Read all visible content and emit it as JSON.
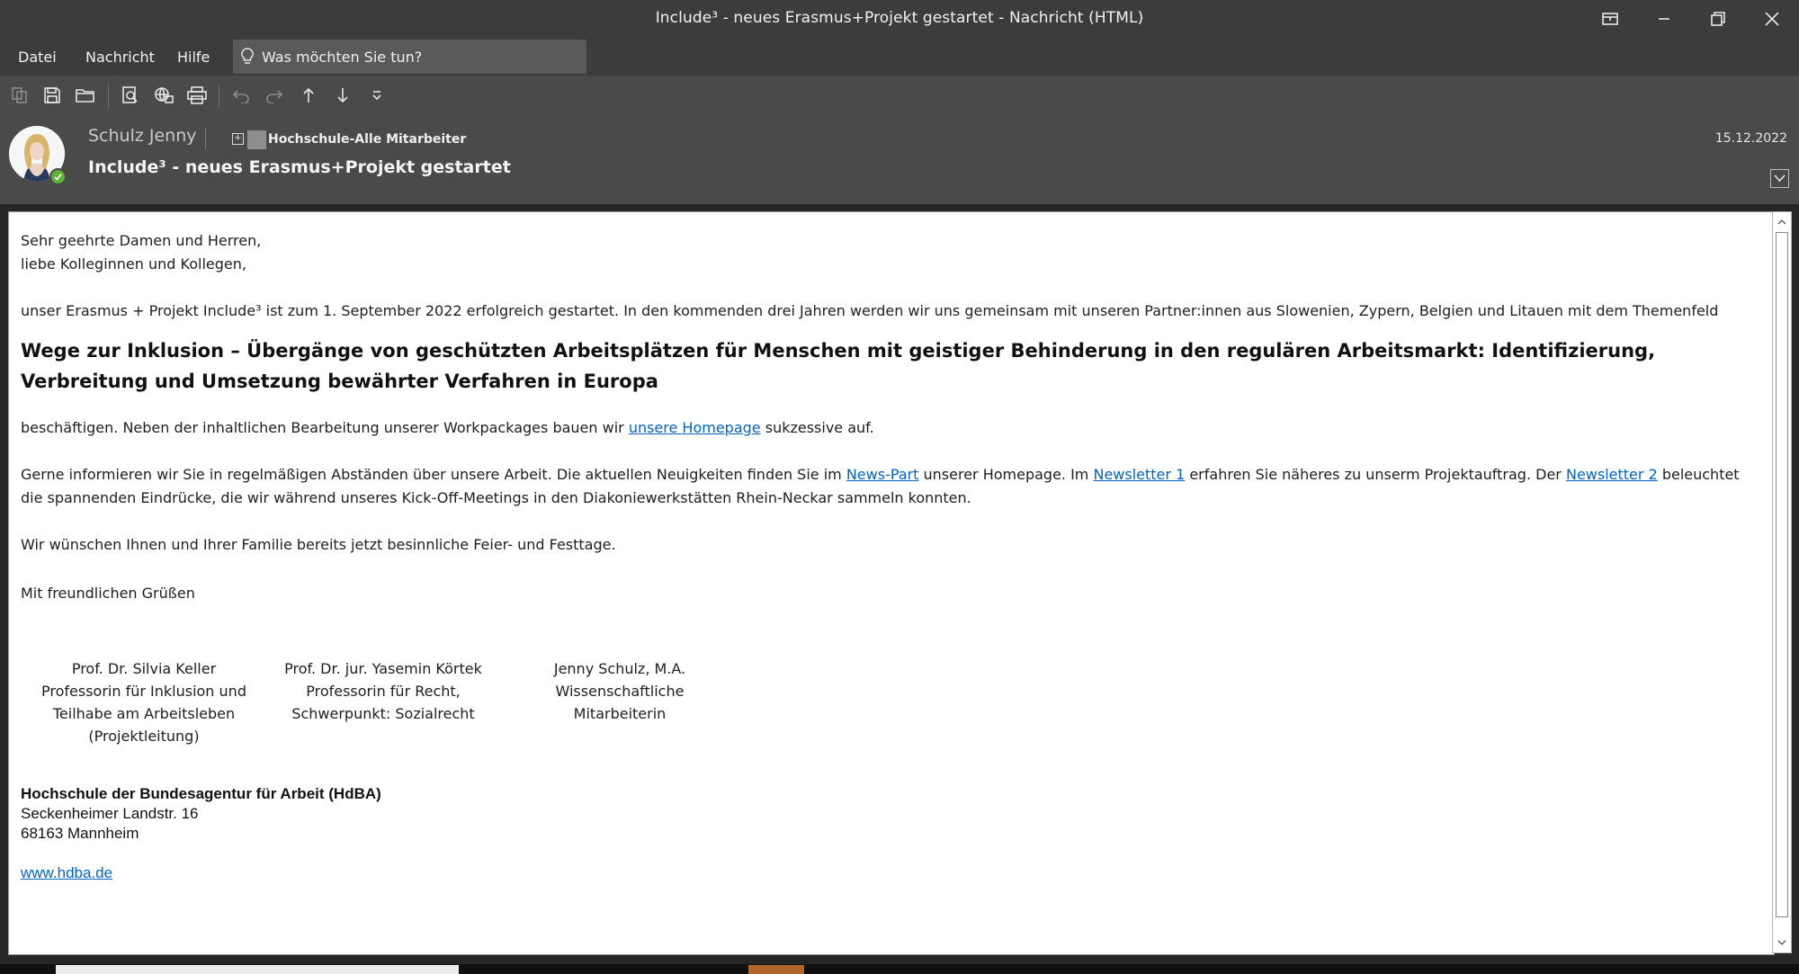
{
  "window": {
    "title": "Include³ - neues Erasmus+Projekt gestartet  -  Nachricht (HTML)"
  },
  "menu": {
    "items": [
      "Datei",
      "Nachricht",
      "Hilfe"
    ],
    "tell_me_placeholder": "Was möchten Sie tun?"
  },
  "header": {
    "sender": "Schulz Jenny",
    "recipient": "Hochschule-Alle Mitarbeiter",
    "subject": "Include³ - neues Erasmus+Projekt gestartet",
    "date": "15.12.2022"
  },
  "mail": {
    "greeting1": "Sehr geehrte Damen und Herren,",
    "greeting2": "liebe Kolleginnen und Kollegen,",
    "intro": "unser Erasmus + Projekt Include³ ist zum 1. September 2022 erfolgreich gestartet. In den kommenden drei Jahren werden wir uns gemeinsam mit unseren Partner:innen aus Slowenien, Zypern, Belgien und Litauen mit dem Themenfeld",
    "heading": "Wege zur Inklusion – Übergänge von geschützten Arbeitsplätzen für Menschen mit geistiger Behinderung in den regulären Arbeitsmarkt: Identifizierung, Verbreitung und Umsetzung bewährter Verfahren in Europa",
    "p2_before": "beschäftigen. Neben der inhaltlichen Bearbeitung unserer Workpackages bauen wir ",
    "p2_link": "unsere Homepage",
    "p2_after": " sukzessive auf.",
    "p3_a": "Gerne informieren wir Sie in regelmäßigen Abständen über unsere Arbeit. Die aktuellen Neuigkeiten finden Sie im ",
    "p3_link1": "News-Part",
    "p3_b": " unserer Homepage. Im ",
    "p3_link2": "Newsletter 1",
    "p3_c": " erfahren Sie näheres zu unserm Projektauftrag. Der ",
    "p3_link3": "Newsletter 2",
    "p3_d": " beleuchtet die spannenden Eindrücke, die wir während unseres Kick-Off-Meetings in den Diakoniewerkstätten Rhein-Neckar sammeln konnten.",
    "p4": "Wir wünschen Ihnen und Ihrer Familie bereits jetzt besinnliche Feier- und Festtage.",
    "closing": "Mit freundlichen Grüßen"
  },
  "signatures": [
    {
      "lines": [
        "Prof. Dr. Silvia Keller",
        "Professorin für Inklusion und",
        "Teilhabe am Arbeitsleben",
        "(Projektleitung)"
      ]
    },
    {
      "lines": [
        "Prof. Dr. jur. Yasemin Körtek",
        "Professorin für Recht,",
        "Schwerpunkt: Sozialrecht"
      ]
    },
    {
      "lines": [
        "Jenny Schulz, M.A.",
        "Wissenschaftliche",
        "Mitarbeiterin"
      ]
    }
  ],
  "organization": {
    "name": "Hochschule der Bundesagentur für Arbeit (HdBA)",
    "street": "Seckenheimer Landstr. 16",
    "city": "68163 Mannheim",
    "website": "www.hdba.de"
  },
  "icons": {
    "toolbar": [
      "copy-icon",
      "save-icon",
      "folder-icon",
      "find-icon",
      "globe-print-icon",
      "print-icon",
      "undo-icon",
      "redo-icon",
      "up-arrow-icon",
      "down-arrow-icon",
      "customize-icon"
    ]
  },
  "colors": {
    "chrome_dark": "#3c3c3c",
    "chrome_mid": "#4a4a4a",
    "link": "#0563c1",
    "presence": "#5db23a"
  }
}
